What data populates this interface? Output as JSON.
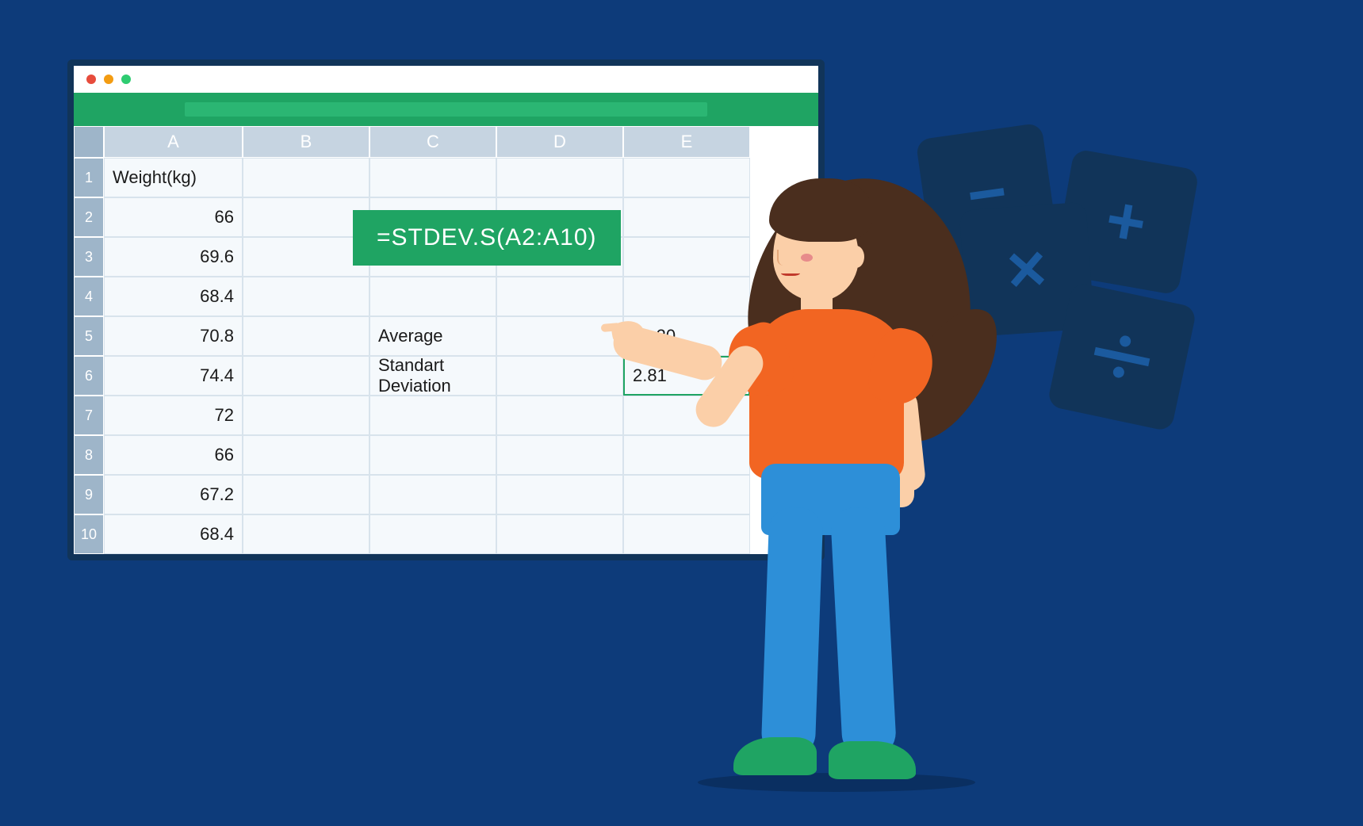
{
  "columns": [
    "A",
    "B",
    "C",
    "D",
    "E"
  ],
  "rows": [
    "1",
    "2",
    "3",
    "4",
    "5",
    "6",
    "7",
    "8",
    "9",
    "10"
  ],
  "cells": {
    "A1": "Weight(kg)",
    "A2": "66",
    "A3": "69.6",
    "A4": "68.4",
    "A5": "70.8",
    "A6": "74.4",
    "A7": "72",
    "A8": "66",
    "A9": "67.2",
    "A10": "68.4",
    "C5": "Average",
    "C6": "Standart Deviation",
    "E5": "69.20",
    "E6": "2.81"
  },
  "formula": "=STDEV.S(A2:A10)",
  "selected_cell": "E6",
  "symbols": {
    "minus": "−",
    "plus": "+",
    "times": "×"
  },
  "chart_data": {
    "type": "table",
    "title": "Weight(kg)",
    "values": [
      66,
      69.6,
      68.4,
      70.8,
      74.4,
      72,
      66,
      67.2,
      68.4
    ],
    "average": 69.2,
    "standard_deviation": 2.81,
    "formula": "=STDEV.S(A2:A10)"
  }
}
